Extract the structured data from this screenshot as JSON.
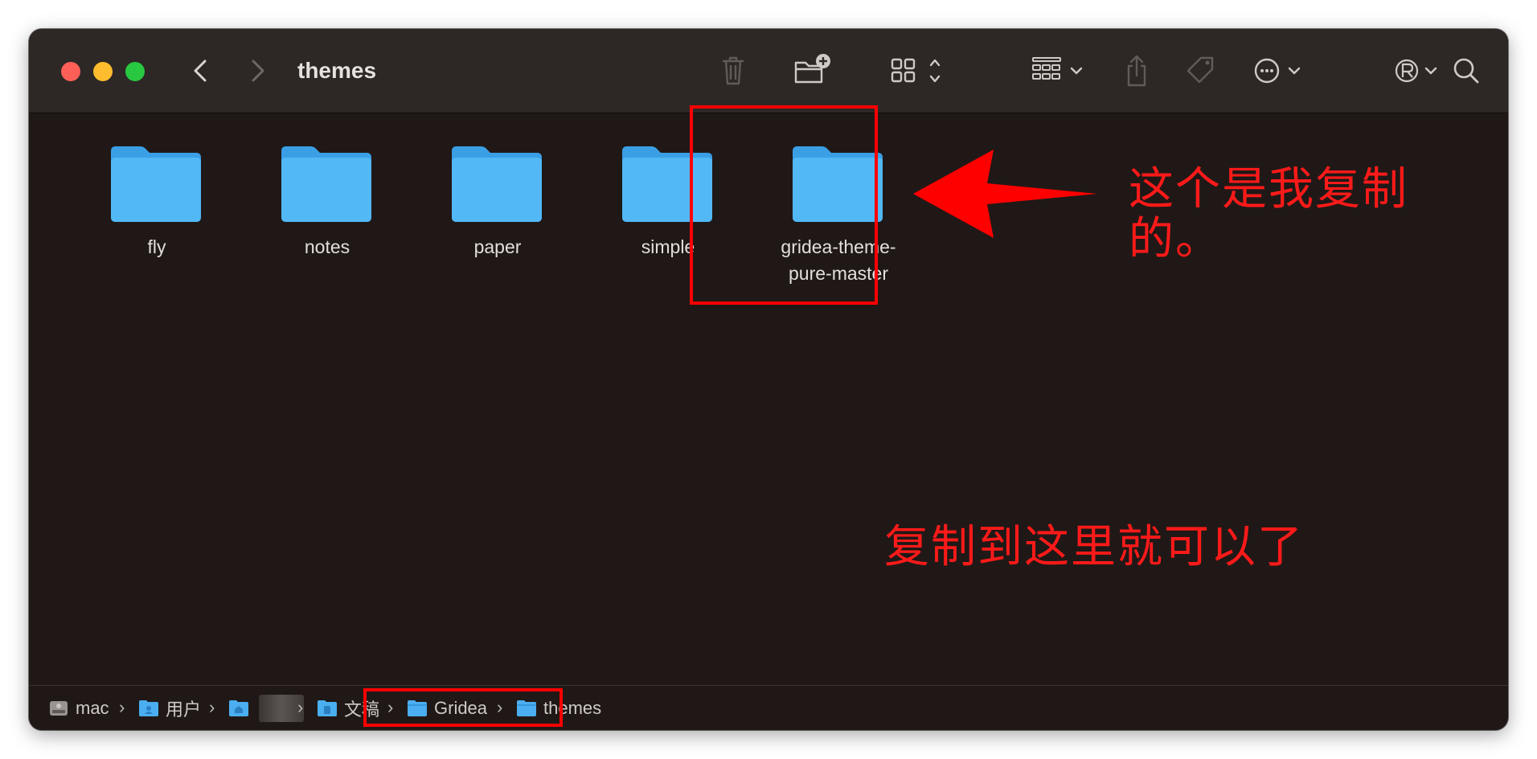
{
  "window": {
    "title": "themes"
  },
  "toolbar": {
    "icons": [
      "trash-icon",
      "new-folder-icon",
      "grid-view-icon",
      "group-icon",
      "share-icon",
      "tag-icon",
      "more-icon",
      "registered-icon",
      "search-icon"
    ]
  },
  "files": [
    {
      "name": "fly"
    },
    {
      "name": "notes"
    },
    {
      "name": "paper"
    },
    {
      "name": "simple"
    },
    {
      "name_line1": "gridea-theme-",
      "name_line2": "pure-master"
    }
  ],
  "annotations": {
    "arrow_note_line1": "这个是我复制",
    "arrow_note_line2": "的。",
    "bottom_note": "复制到这里就可以了",
    "color": "#ff0000"
  },
  "pathbar": {
    "items": [
      {
        "label": "mac",
        "icon": "disk-icon"
      },
      {
        "label": "用户",
        "icon": "users-folder-icon"
      },
      {
        "label": "",
        "icon": "home-folder-icon"
      },
      {
        "label": "文稿",
        "icon": "documents-folder-icon"
      },
      {
        "label": "Gridea",
        "icon": "folder-icon"
      },
      {
        "label": "themes",
        "icon": "folder-icon"
      }
    ],
    "separator": "›"
  },
  "colors": {
    "folder": "#4fb4f4",
    "folder_tab": "#3fa4ea",
    "window_bg": "#201816",
    "toolbar_bg": "#2d2826"
  }
}
